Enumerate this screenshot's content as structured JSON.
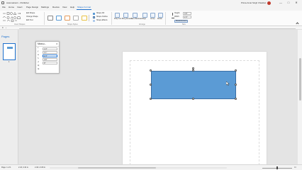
{
  "titlebar": {
    "app_title": "Automation1 - Publisher",
    "account_name": "Prince Amar Singh Chauhan",
    "minimize": "—",
    "maximize": "□",
    "close": "✕"
  },
  "tabs": [
    {
      "label": "File"
    },
    {
      "label": "Home"
    },
    {
      "label": "Insert"
    },
    {
      "label": "Page Design"
    },
    {
      "label": "Mailings"
    },
    {
      "label": "Review"
    },
    {
      "label": "View"
    },
    {
      "label": "Help"
    },
    {
      "label": "Shape Format",
      "active": true
    }
  ],
  "ribbon": {
    "insert_shapes": {
      "edit_shape": "Edit Shape",
      "change_shape": "Change Shape",
      "edit_text": "Edit Text",
      "group_label": "Insert Shapes"
    },
    "shape_styles": {
      "group_label": "Shape Styles",
      "shape_fill": "Shape Fill",
      "shape_outline": "Shape Outline",
      "shape_effects": "Shape Effects"
    },
    "arrange": {
      "group_label": "Arrange",
      "wrap_text": "Wrap Text",
      "bring_forward": "Bring Forward",
      "send_backward": "Send Backward",
      "align": "Align",
      "group": "Group",
      "rotate": "Rotate"
    },
    "size": {
      "group_label": "Size",
      "height_label": "Height:",
      "height_value": "0.8\"",
      "width_label": "Width:",
      "width_value": "2.4\"",
      "measurement": "Measurement"
    }
  },
  "pages_panel": {
    "title": "Pages",
    "thumbnail_number": "1"
  },
  "measurement_panel": {
    "title": "Measu...",
    "rows": [
      {
        "label": "x",
        "value": "1.9\""
      },
      {
        "label": "y",
        "value": "1.1\""
      },
      {
        "label": "w",
        "value": "2.4\""
      },
      {
        "label": "h",
        "value": "0.8\""
      },
      {
        "label": "∠",
        "value": "0°"
      },
      {
        "label": "A|",
        "value": ""
      },
      {
        "label": "A|",
        "value": ""
      }
    ]
  },
  "status": {
    "page": "Page: 1 of 1",
    "position": "2.43, 0.32 in.",
    "size": "2.40 x 0.80 in."
  },
  "colors": {
    "accent": "#1e70cd",
    "shape_fill": "#5b9bd5",
    "shape_border": "#3a6ea5",
    "avatar": "#c0392b"
  }
}
